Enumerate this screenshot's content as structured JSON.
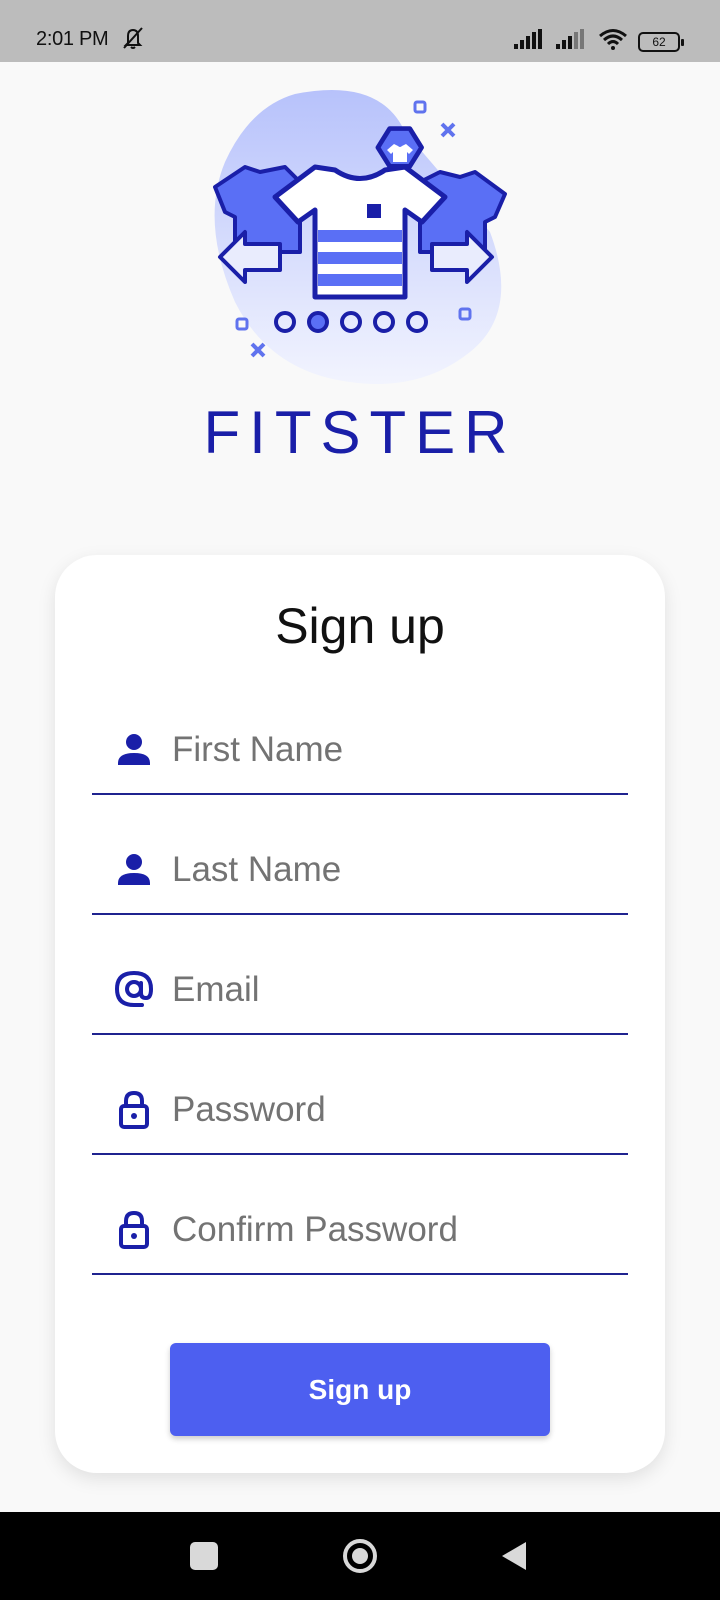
{
  "status_bar": {
    "time": "2:01 PM",
    "battery": "62"
  },
  "brand": {
    "name": "FITSTER",
    "color": "#1a1fa8"
  },
  "form": {
    "title": "Sign up",
    "fields": [
      {
        "name": "first-name",
        "icon": "person-icon",
        "placeholder": "First Name",
        "value": ""
      },
      {
        "name": "last-name",
        "icon": "person-icon",
        "placeholder": "Last Name",
        "value": ""
      },
      {
        "name": "email",
        "icon": "at-icon",
        "placeholder": "Email",
        "value": ""
      },
      {
        "name": "password",
        "icon": "lock-icon",
        "placeholder": "Password",
        "value": ""
      },
      {
        "name": "confirm-password",
        "icon": "lock-icon",
        "placeholder": "Confirm Password",
        "value": ""
      }
    ],
    "submit_label": "Sign up",
    "accent_color": "#4d5ff0",
    "underline_color": "#1f238f"
  },
  "navigation": {
    "buttons": [
      "recents-button",
      "home-button",
      "back-button"
    ]
  }
}
